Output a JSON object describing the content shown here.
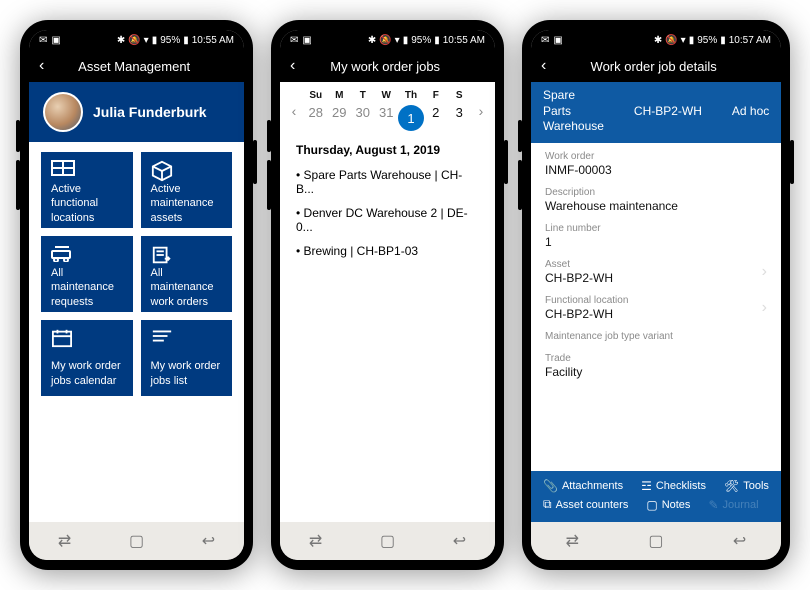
{
  "statusbar": {
    "time": "10:55 AM",
    "time3": "10:57 AM",
    "battery": "95%"
  },
  "screen1": {
    "title": "Asset Management",
    "user_name": "Julia Funderburk",
    "tiles": [
      "Active functional locations",
      "Active maintenance assets",
      "All maintenance requests",
      "All maintenance work orders",
      "My work order jobs calendar",
      "My work order jobs list"
    ]
  },
  "screen2": {
    "title": "My work order jobs",
    "dow": [
      "Su",
      "M",
      "T",
      "W",
      "Th",
      "F",
      "S"
    ],
    "days": [
      "28",
      "29",
      "30",
      "31",
      "1",
      "2",
      "3"
    ],
    "selected_index": 4,
    "date_label": "Thursday, August 1, 2019",
    "items": [
      "Spare Parts Warehouse | CH-B...",
      "Denver DC Warehouse 2 | DE-0...",
      "Brewing | CH-BP1-03"
    ]
  },
  "screen3": {
    "title": "Work order job details",
    "tabs": [
      "Spare Parts Warehouse",
      "CH-BP2-WH",
      "Ad hoc"
    ],
    "fields": [
      {
        "label": "Work order",
        "value": "INMF-00003"
      },
      {
        "label": "Description",
        "value": "Warehouse maintenance"
      },
      {
        "label": "Line number",
        "value": "1"
      },
      {
        "label": "Asset",
        "value": "CH-BP2-WH",
        "chevron": true
      },
      {
        "label": "Functional location",
        "value": "CH-BP2-WH",
        "chevron": true
      },
      {
        "label": "Maintenance job type variant",
        "value": ""
      },
      {
        "label": "Trade",
        "value": "Facility"
      }
    ],
    "actions_row1": [
      "Attachments",
      "Checklists",
      "Tools"
    ],
    "actions_row2": [
      "Asset counters",
      "Notes",
      "Journal"
    ]
  }
}
